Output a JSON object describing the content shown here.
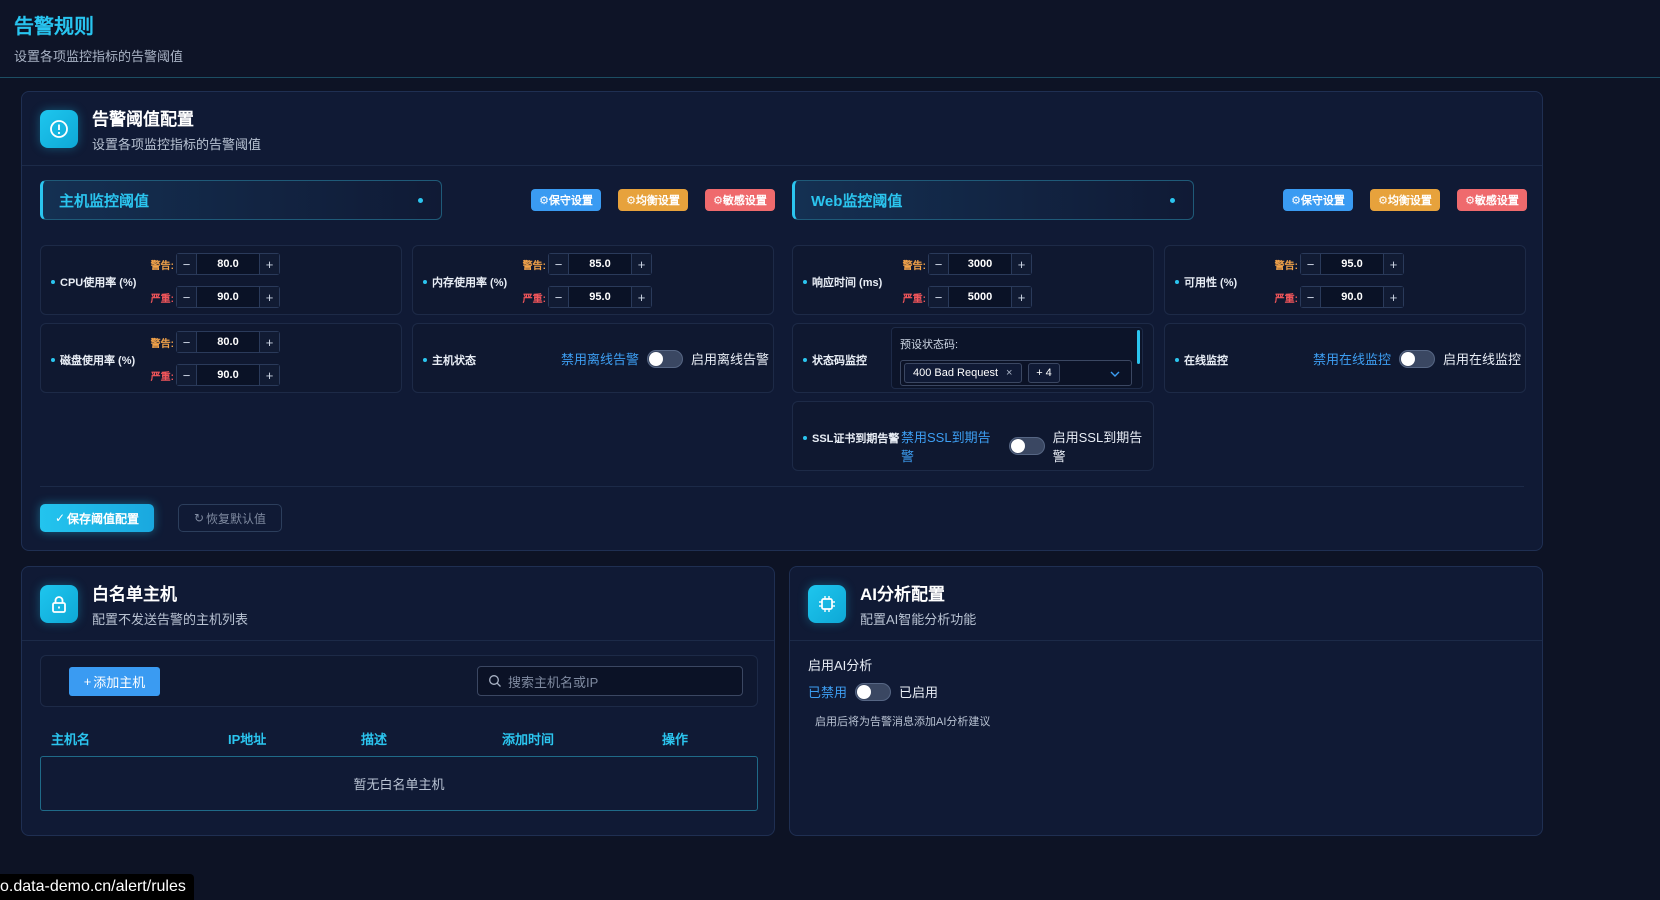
{
  "page": {
    "title": "告警规则",
    "subtitle": "设置各项监控指标的告警阈值"
  },
  "threshold_card": {
    "title": "告警阈值配置",
    "subtitle": "设置各项监控指标的告警阈值",
    "host_section": {
      "title": "主机监控阈值",
      "presets": [
        "⚙保守设置",
        "⚙均衡设置",
        "⚙敏感设置"
      ],
      "cpu": {
        "label": "CPU使用率 (%)",
        "warn": "80.0",
        "crit": "90.0"
      },
      "mem": {
        "label": "内存使用率 (%)",
        "warn": "85.0",
        "crit": "95.0"
      },
      "disk": {
        "label": "磁盘使用率 (%)",
        "warn": "80.0",
        "crit": "90.0"
      },
      "status": {
        "label": "主机状态",
        "off": "禁用离线告警",
        "on": "启用离线告警"
      }
    },
    "web_section": {
      "title": "Web监控阈值",
      "presets": [
        "⚙保守设置",
        "⚙均衡设置",
        "⚙敏感设置"
      ],
      "resp": {
        "label": "响应时间 (ms)",
        "warn": "3000",
        "crit": "5000"
      },
      "avail": {
        "label": "可用性 (%)",
        "warn": "95.0",
        "crit": "90.0"
      },
      "code": {
        "label": "状态码监控",
        "preset_label": "预设状态码:",
        "tag": "400 Bad Request",
        "more": "+ 4"
      },
      "online": {
        "label": "在线监控",
        "off": "禁用在线监控",
        "on": "启用在线监控"
      },
      "ssl": {
        "label": "SSL证书到期告警",
        "off": "禁用SSL到期告警",
        "on": "启用SSL到期告警"
      }
    },
    "warn_tag": "警告:",
    "crit_tag": "严重:",
    "save_button": "保存阈值配置",
    "reset_button": "恢复默认值"
  },
  "whitelist_card": {
    "title": "白名单主机",
    "subtitle": "配置不发送告警的主机列表",
    "add_button": "添加主机",
    "search_placeholder": "搜索主机名或IP",
    "columns": [
      "主机名",
      "IP地址",
      "描述",
      "添加时间",
      "操作"
    ],
    "empty_text": "暂无白名单主机"
  },
  "ai_card": {
    "title": "AI分析配置",
    "subtitle": "配置AI智能分析功能",
    "field_label": "启用AI分析",
    "off": "已禁用",
    "on": "已启用",
    "hint": "启用后将为告警消息添加AI分析建议"
  },
  "status_url": "o.data-demo.cn/alert/rules",
  "colors": {
    "accent": "#2bc5ef",
    "warn": "#f3a34a",
    "critical": "#f0555a",
    "link": "#3d9ef2"
  }
}
